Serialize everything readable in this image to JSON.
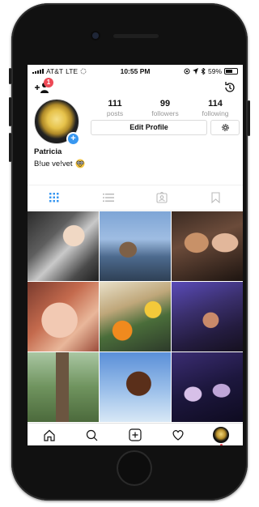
{
  "status_bar": {
    "carrier": "AT&T",
    "network": "LTE",
    "time": "10:55 PM",
    "battery": "59%"
  },
  "header": {
    "notification_count": "1"
  },
  "profile": {
    "stats": [
      {
        "value": "111",
        "label": "posts"
      },
      {
        "value": "99",
        "label": "followers"
      },
      {
        "value": "114",
        "label": "following"
      }
    ],
    "edit_profile_label": "Edit Profile",
    "name": "Patricia",
    "bio": "B!ue ve!vet"
  },
  "tabs": [
    {
      "icon": "grid-icon",
      "active": true
    },
    {
      "icon": "list-icon",
      "active": false
    },
    {
      "icon": "tagged-icon",
      "active": false
    },
    {
      "icon": "bookmark-icon",
      "active": false
    }
  ],
  "bottom_nav": [
    "home-icon",
    "search-icon",
    "add-post-icon",
    "heart-icon",
    "profile-avatar"
  ],
  "colors": {
    "accent_blue": "#3897f0",
    "badge_red": "#ed4956",
    "muted_gray": "#999999"
  }
}
